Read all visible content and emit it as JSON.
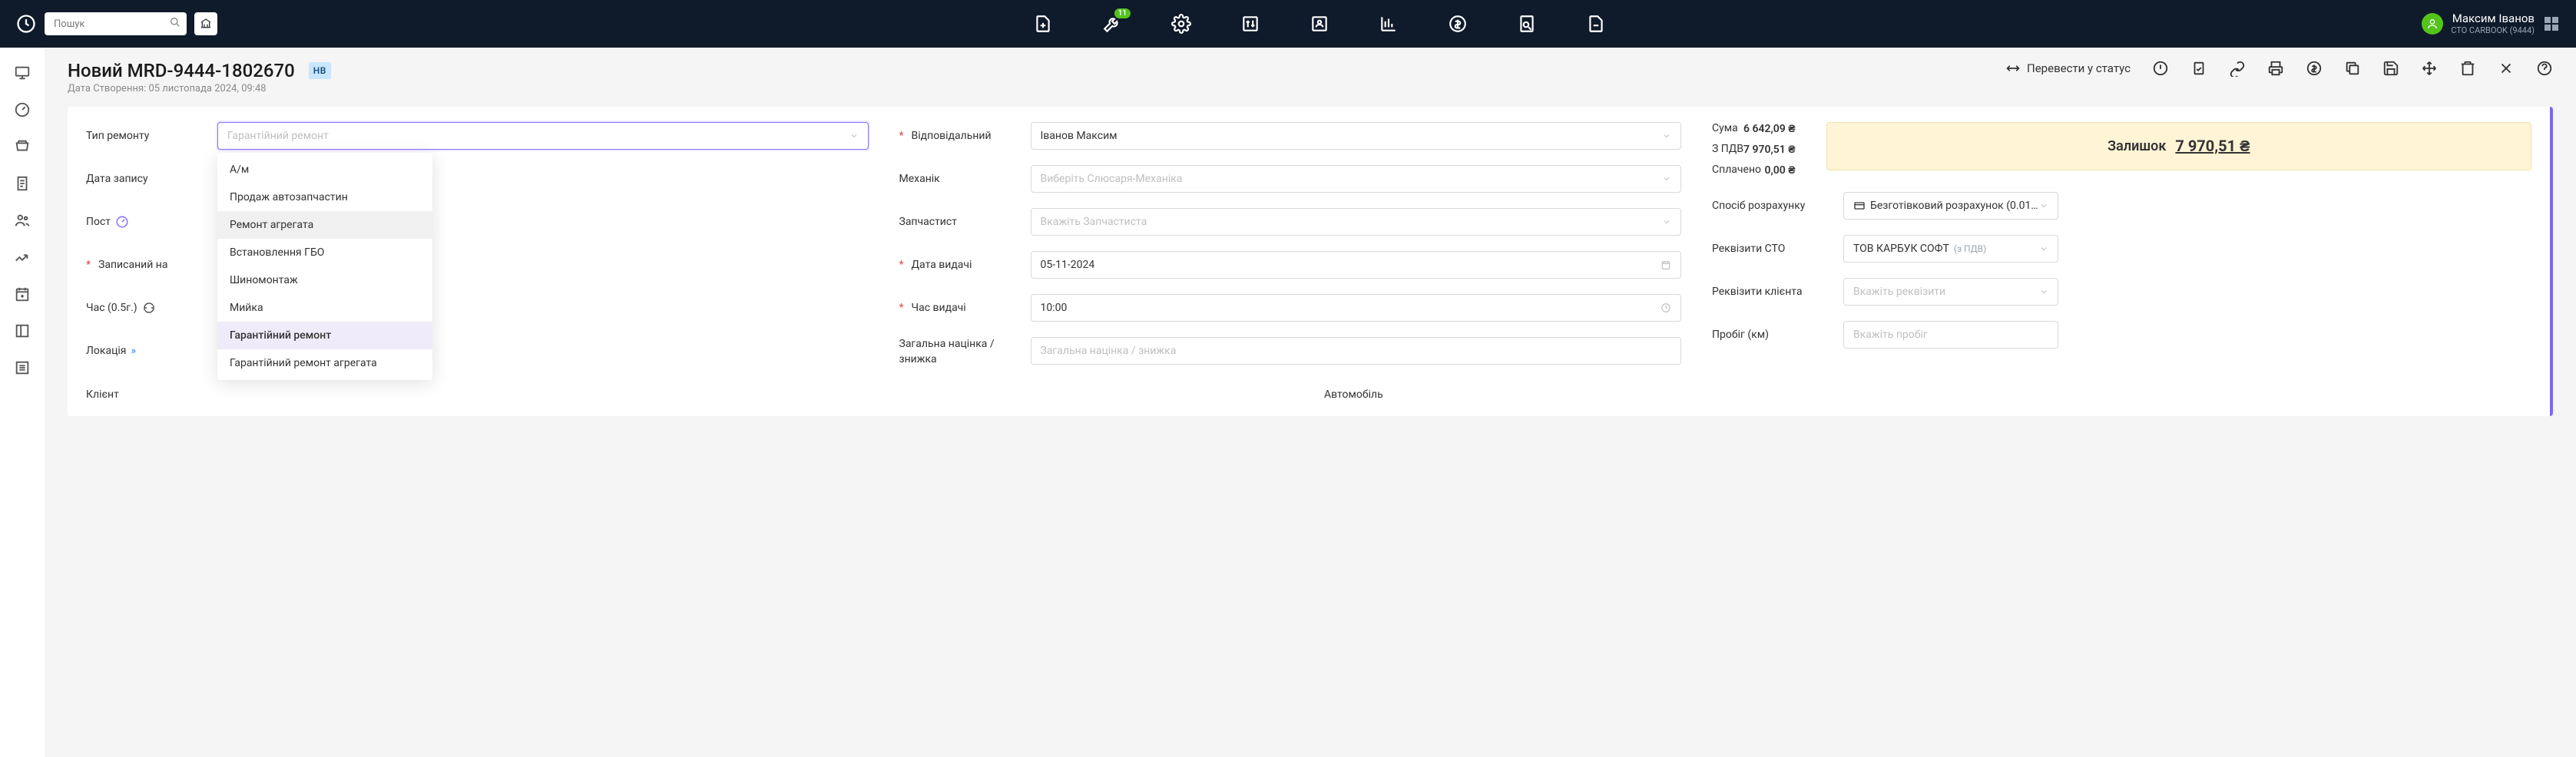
{
  "search": {
    "placeholder": "Пошук"
  },
  "nav_badge": "11",
  "user": {
    "name": "Максим Іванов",
    "sub": "СТО CARBOOK (9444)"
  },
  "header": {
    "title": "Новий MRD-9444-1802670",
    "chip": "НВ",
    "date_label": "Дата Створення: 05 листопада 2024, 09:48",
    "status_transfer": "Перевести у статус"
  },
  "fields": {
    "repair_type": "Тип ремонту",
    "repair_type_ph": "Гарантійний ремонт",
    "record_date": "Дата запису",
    "post": "Пост",
    "assigned_to": "Записаний на",
    "time_half": "Час (0.5г.)",
    "location": "Локація",
    "responsible": "Відповідальний",
    "responsible_val": "Іванов Максим",
    "mechanic": "Механік",
    "mechanic_ph": "Виберіть Слюсаря-Механіка",
    "parts_specialist": "Запчастист",
    "parts_ph": "Вкажіть Запчастиста",
    "issue_date": "Дата видачі",
    "issue_date_val": "05-11-2024",
    "issue_time": "Час видачі",
    "issue_time_val": "10:00",
    "markup": "Загальна націнка / знижка",
    "markup_ph": "Загальна націнка / знижка"
  },
  "dropdown": {
    "items": [
      "А/м",
      "Продаж автозапчастин",
      "Ремонт агрегата",
      "Встановлення ГБО",
      "Шиномонтаж",
      "Мийка",
      "Гарантійний ремонт",
      "Гарантійний ремонт агрегата"
    ]
  },
  "summary": {
    "sum_label": "Сума",
    "sum_val": "6 642,09 ₴",
    "vat_label": "З ПДВ",
    "vat_val": "7 970,51 ₴",
    "paid_label": "Сплачено",
    "paid_val": "0,00 ₴",
    "balance_label": "Залишок",
    "balance_val": "7 970,51 ₴"
  },
  "right": {
    "payment": "Спосіб розрахунку",
    "payment_val": "Безготівковий розрахунок (0.01…",
    "sto_req": "Реквізити СТО",
    "sto_req_val": "ТОВ КАРБУК СОФТ",
    "sto_req_sub": "(з ПДВ)",
    "client_req": "Реквізити клієнта",
    "client_req_ph": "Вкажіть реквізити",
    "mileage": "Пробіг (км)",
    "mileage_ph": "Вкажіть пробіг"
  },
  "bottom": {
    "client": "Клієнт",
    "car": "Автомобіль"
  }
}
